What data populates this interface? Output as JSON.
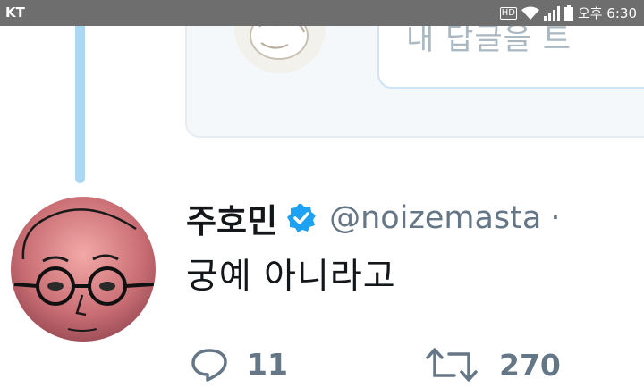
{
  "status_bar": {
    "carrier": "KT",
    "hd_label": "HD",
    "time": "오후 6:30"
  },
  "quote_card": {
    "reply_placeholder": "내 답글을 트"
  },
  "tweet": {
    "display_name": "주호민",
    "handle": "@noizemasta",
    "separator": "·",
    "text": "궁예 아니라고",
    "reply_count": "11",
    "retweet_count": "270"
  },
  "colors": {
    "status_bar_bg": "#6e6e6e",
    "thread_line": "#a8d8f3",
    "verified_badge": "#1da1f2",
    "secondary_text": "#657786",
    "primary_text": "#14171a"
  }
}
